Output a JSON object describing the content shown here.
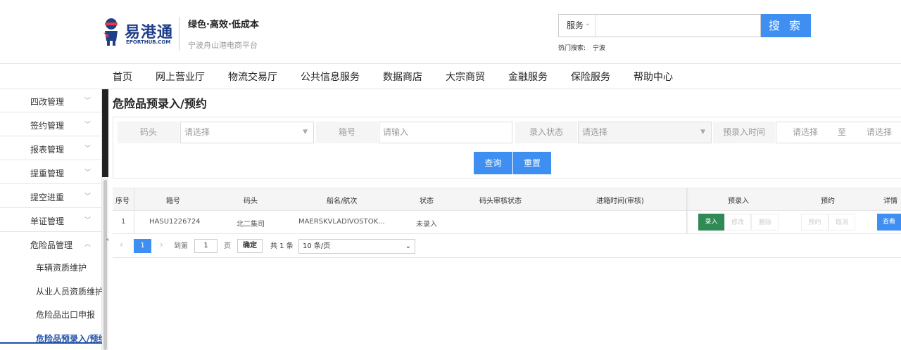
{
  "header": {
    "logo_text": "易港通",
    "logo_sub": "EPORTHUB.COM",
    "slogan": "绿色·高效·低成本",
    "subslogan": "宁波舟山港电商平台",
    "search": {
      "type_label": "服务",
      "placeholder": "",
      "button_label": "搜 索",
      "hot_label": "热门搜索:",
      "hot_value": "宁波"
    }
  },
  "nav": [
    {
      "label": "首页"
    },
    {
      "label": "网上营业厅"
    },
    {
      "label": "物流交易厅"
    },
    {
      "label": "公共信息服务"
    },
    {
      "label": "数据商店"
    },
    {
      "label": "大宗商贸"
    },
    {
      "label": "金融服务"
    },
    {
      "label": "保险服务"
    },
    {
      "label": "帮助中心"
    }
  ],
  "sidebar": {
    "items": [
      {
        "label": "四改管理"
      },
      {
        "label": "签约管理"
      },
      {
        "label": "报表管理"
      },
      {
        "label": "提重管理"
      },
      {
        "label": "提空进重"
      },
      {
        "label": "单证管理"
      },
      {
        "label": "危险品管理"
      }
    ],
    "subitems": [
      {
        "label": "车辆资质维护"
      },
      {
        "label": "从业人员资质维护"
      },
      {
        "label": "危险品出口申报"
      },
      {
        "label": "危险品预录入/预约"
      }
    ]
  },
  "main": {
    "title": "危险品预录入/预约",
    "filters": {
      "terminal_label": "码头",
      "terminal_placeholder": "请选择",
      "container_label": "箱号",
      "container_placeholder": "请输入",
      "status_label": "录入状态",
      "status_placeholder": "请选择",
      "time_label": "预录入时间",
      "time_start": "请选择",
      "time_to": "至",
      "time_end": "请选择"
    },
    "buttons": {
      "query": "查询",
      "reset": "重置"
    },
    "table": {
      "headers": {
        "seq": "序号",
        "container": "箱号",
        "terminal": "码头",
        "vessel": "船名/航次",
        "status": "状态",
        "audit": "码头审核状态",
        "entry_time": "进箱时间(审核)",
        "pre_entry": "预录入",
        "booking": "预约",
        "detail": "详情"
      },
      "rows": [
        {
          "seq": "1",
          "container": "HASU1226724",
          "terminal": "北二集司",
          "vessel": "MAERSKVLADIVOSTOK...",
          "status": "未录入",
          "audit": "",
          "entry_time": "",
          "actions": {
            "enter": "录入",
            "modify": "修改",
            "delete": "删除",
            "book": "预约",
            "cancel": "取消",
            "view": "查看"
          }
        }
      ]
    },
    "pagination": {
      "current": "1",
      "goto_label": "到第",
      "page_input": "1",
      "page_unit": "页",
      "confirm": "确定",
      "total": "共 1 条",
      "page_size": "10 条/页"
    }
  }
}
